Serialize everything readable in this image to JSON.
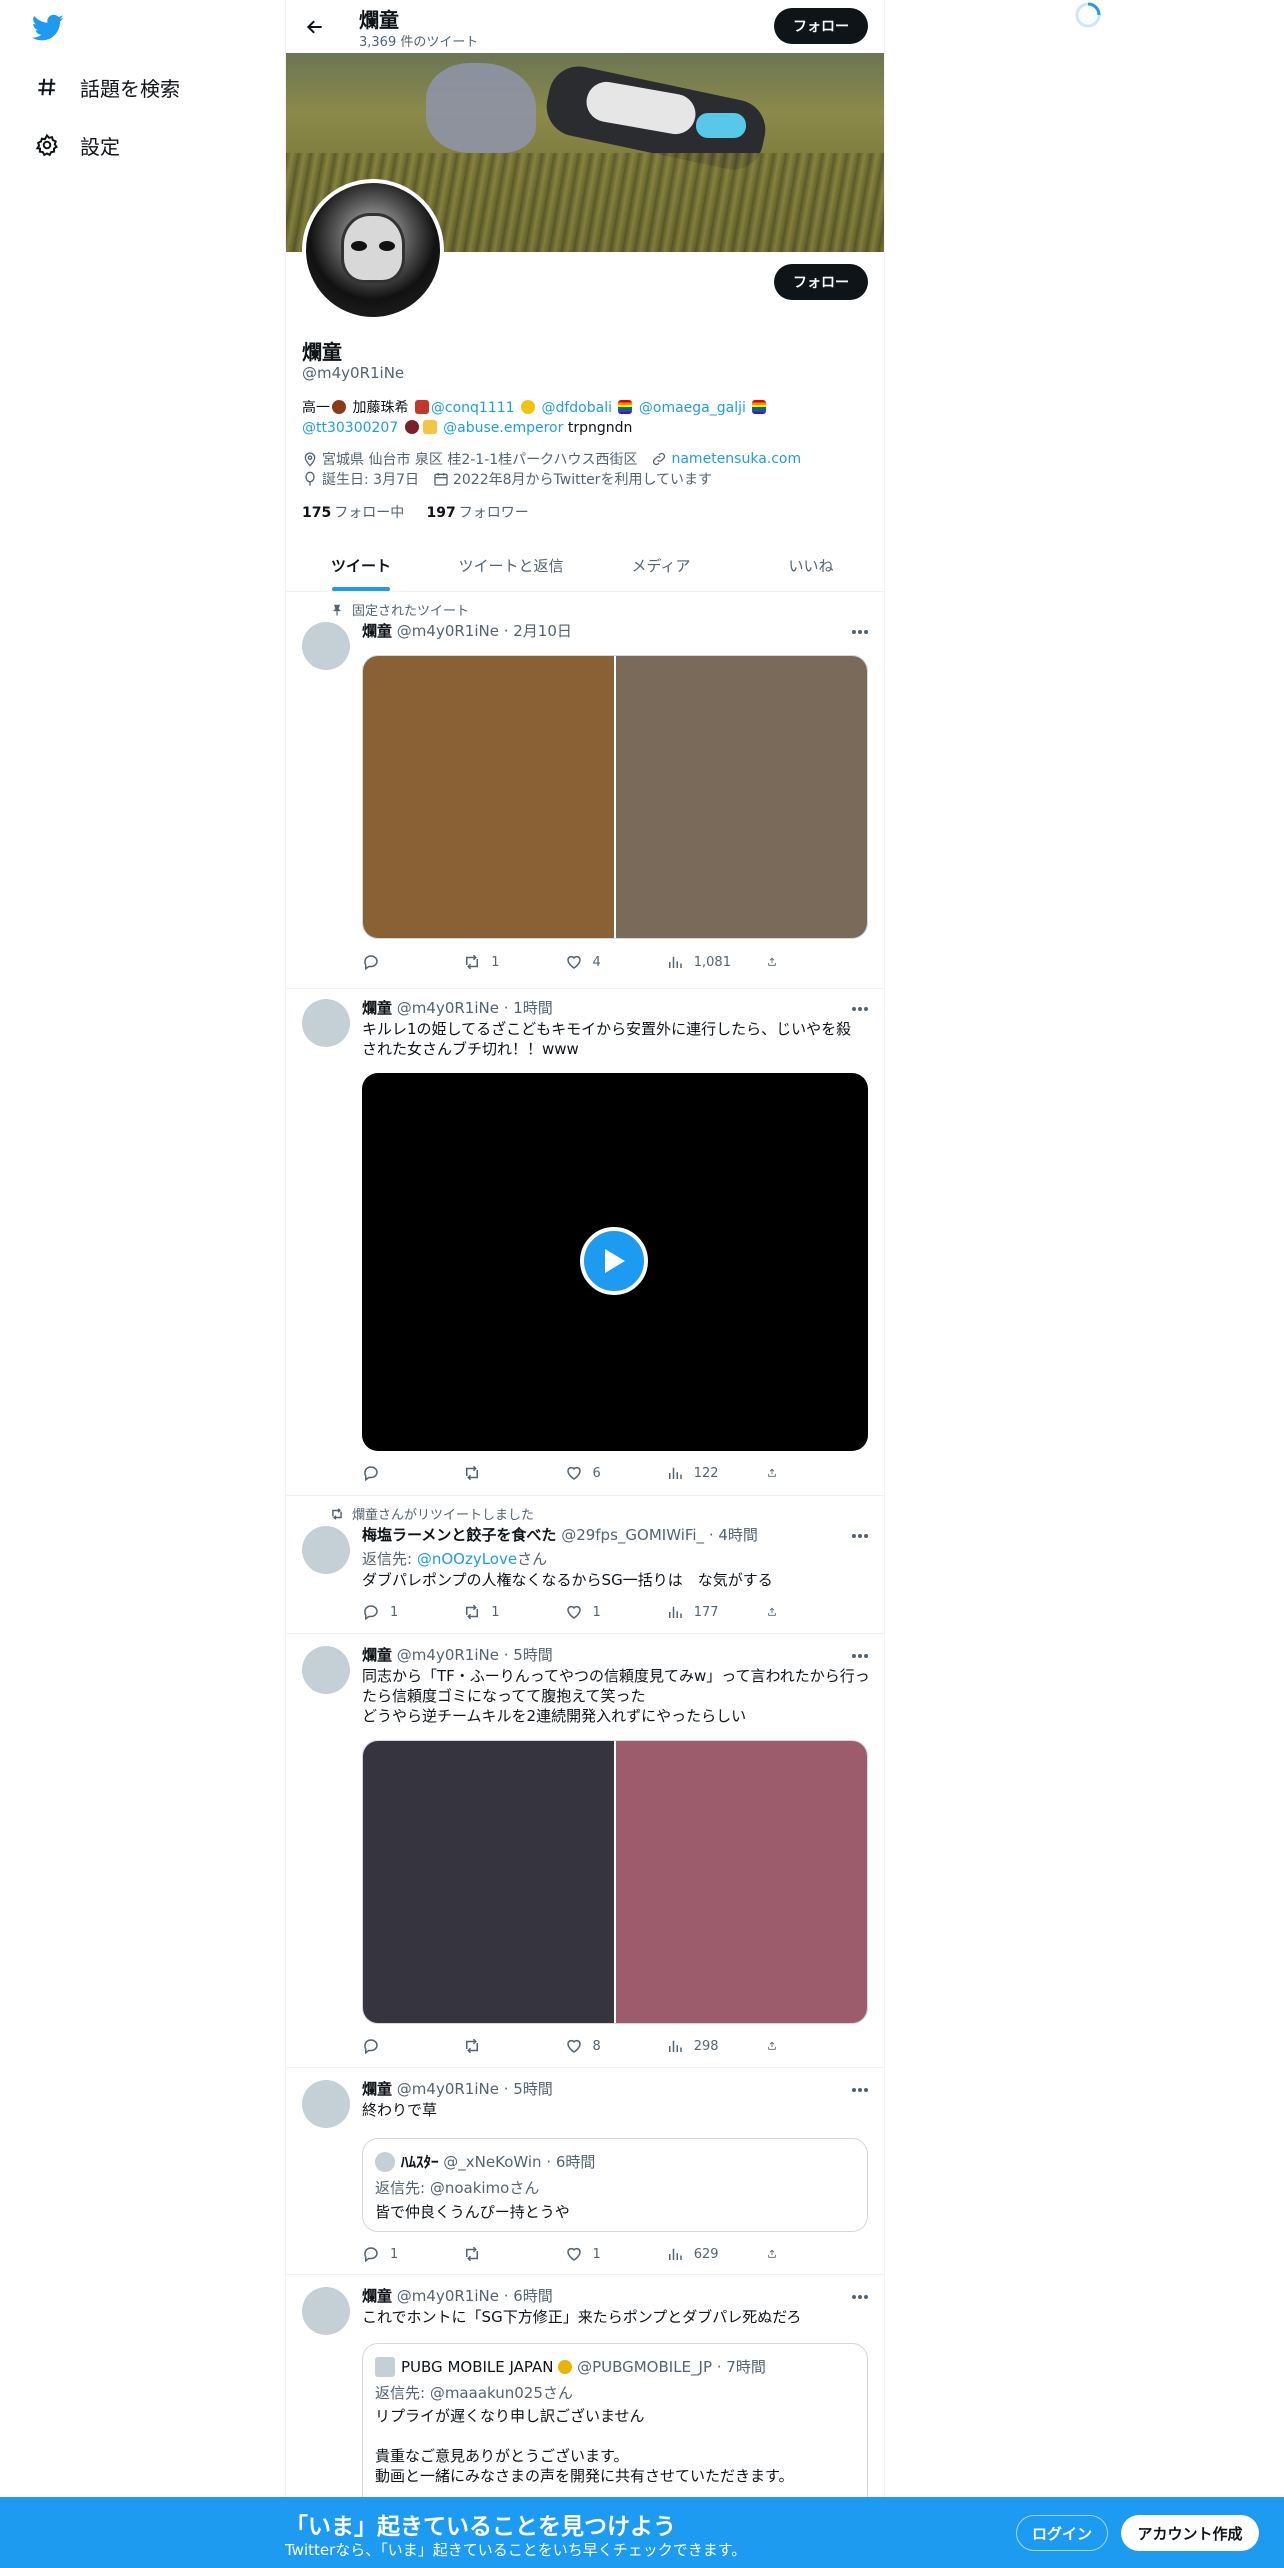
{
  "nav": {
    "explore_label": "話題を検索",
    "settings_label": "設定"
  },
  "header": {
    "name": "爛童",
    "tweet_count": "3,369 件のツイート",
    "follow_label": "フォロー"
  },
  "profile": {
    "name": "爛童",
    "handle": "@m4y0R1iNe",
    "follow_label": "フォロー",
    "bio": {
      "t1": "高一",
      "t2": " 加藤珠希 ",
      "m1": "@conq1111",
      "m2": "@dfdobali",
      "m3": "@omaega_galji",
      "m4": "@tt30300207",
      "m5": "@abuse.emperor",
      "t3": " trpngndn"
    },
    "location": "宮城県 仙台市 泉区 桂2-1-1桂パークハウス西街区",
    "url": "nametensuka.com",
    "birthday": "誕生日: 3月7日",
    "joined": "2022年8月からTwitterを利用しています",
    "following_count": "175",
    "following_label": "フォロー中",
    "followers_count": "197",
    "followers_label": "フォロワー"
  },
  "tabs": [
    {
      "label": "ツイート"
    },
    {
      "label": "ツイートと返信"
    },
    {
      "label": "メディア"
    },
    {
      "label": "いいね"
    }
  ],
  "tweets": [
    {
      "context": "固定されたツイート",
      "name": "爛童",
      "meta": "@m4y0R1iNe · 2月10日",
      "replies": "",
      "retweets": "1",
      "likes": "4",
      "views": "1,081",
      "media_colors": [
        "#8a6135",
        "#7a6a5a"
      ]
    },
    {
      "name": "爛童",
      "meta": "@m4y0R1iNe · 1時間",
      "text": "キルレ1の姫してるざこどもキモイから安置外に連行したら、じいやを殺\nされた女さんブチ切れ！！www",
      "replies": "",
      "retweets": "",
      "likes": "6",
      "views": "122"
    },
    {
      "context": "爛童さんがリツイートしました",
      "name": "梅塩ラーメンと餃子を食べた",
      "meta": "@29fps_GOMIWiFi_ · 4時間",
      "reply_prefix": "返信先: ",
      "reply_to": "@nOOzyLove",
      "reply_suffix": "さん",
      "text": "ダブパレポンプの人権なくなるからSG一括りは　な気がする",
      "replies": "1",
      "retweets": "1",
      "likes": "1",
      "views": "177"
    },
    {
      "name": "爛童",
      "meta": "@m4y0R1iNe · 5時間",
      "text": "同志から「TF・ふーりんってやつの信頼度見てみw」って言われたから行っ\nたら信頼度ゴミになってて腹抱えて笑った\nどうやら逆チームキルを2連続開発入れずにやったらしい",
      "replies": "",
      "retweets": "",
      "likes": "8",
      "views": "298",
      "media_colors": [
        "#35343f",
        "#9c5c6c"
      ]
    },
    {
      "name": "爛童",
      "meta": "@m4y0R1iNe · 5時間",
      "text": "終わりで草",
      "quote": {
        "name": "ﾊﾑｽﾀｰ",
        "meta": "@_xNeKoWin · 6時間",
        "reply": "返信先: @noakimoさん",
        "text": "皆で仲良くうんぴー持とうや"
      },
      "replies": "1",
      "retweets": "",
      "likes": "1",
      "views": "629"
    },
    {
      "name": "爛童",
      "meta": "@m4y0R1iNe · 6時間",
      "text": "これでホントに「SG下方修正」来たらポンプとダブパレ死ぬだろ",
      "quote": {
        "name": "PUBG MOBILE JAPAN",
        "meta": "@PUBGMOBILE_JP · 7時間",
        "reply": "返信先: @maaakun025さん",
        "text": "リプライが遅くなり申し訳ございません\n\n貴重なご意見ありがとうございます。\n動画と一緒にみなさまの声を開発に共有させていただきます。"
      }
    }
  ],
  "bottom_bar": {
    "title": "「いま」起きていることを見つけよう",
    "subtitle": "Twitterなら、「いま」起きていることをいち早くチェックできます。",
    "login_label": "ログイン",
    "signup_label": "アカウント作成"
  }
}
